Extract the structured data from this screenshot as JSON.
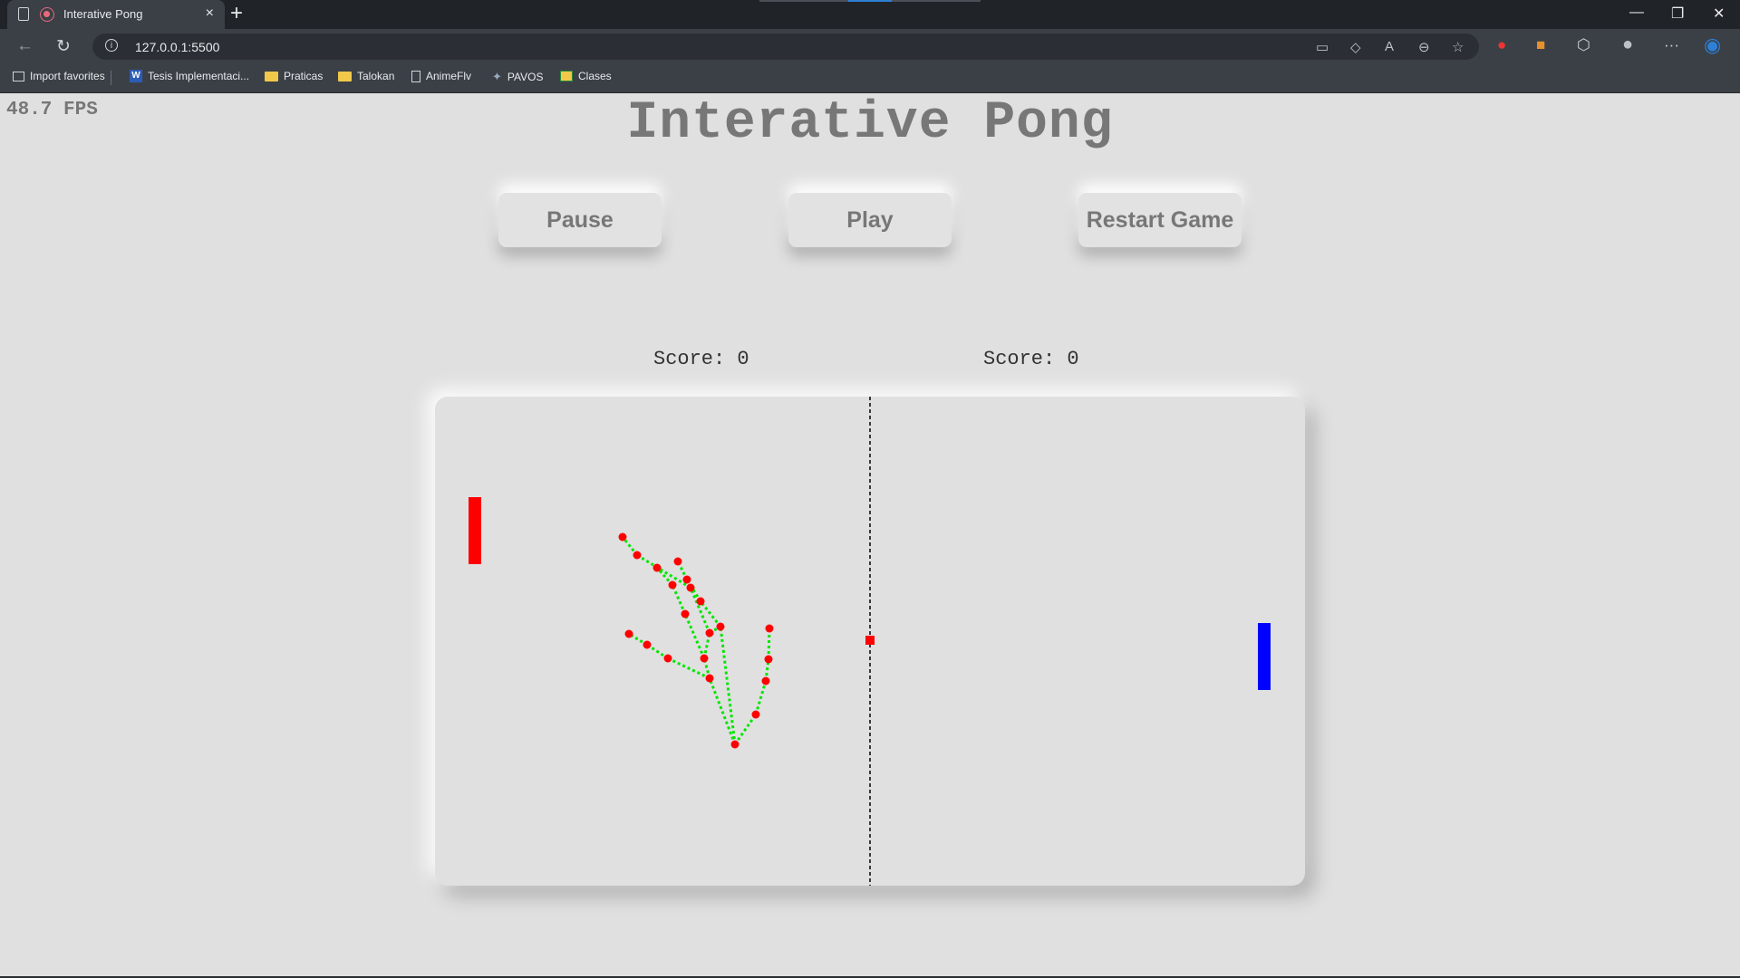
{
  "browser": {
    "tab_title": "Interative Pong",
    "tab_close": "×",
    "new_tab": "+",
    "url": "127.0.0.1:5500",
    "bookmarks": [
      {
        "label": "Import favorites",
        "icon": "import-icon"
      },
      {
        "label": "Tesis Implementaci...",
        "icon": "word-icon"
      },
      {
        "label": "Praticas",
        "icon": "folder-icon"
      },
      {
        "label": "Talokan",
        "icon": "folder-icon"
      },
      {
        "label": "AnimeFlv",
        "icon": "page-icon"
      },
      {
        "label": "PAVOS",
        "icon": "site-icon"
      },
      {
        "label": "Clases",
        "icon": "classroom-icon"
      }
    ]
  },
  "page": {
    "fps": "48.7 FPS",
    "title": "Interative Pong",
    "buttons": {
      "pause": "Pause",
      "play": "Play",
      "restart": "Restart Game"
    },
    "scores": {
      "left": "Score: 0",
      "right": "Score: 0"
    }
  },
  "game": {
    "left_paddle_color": "#ff0000",
    "right_paddle_color": "#0000ff",
    "ball_color": "#ff0000",
    "hand_landmark_color": "#ff0000",
    "hand_skeleton_color": "#00e600",
    "center_line_color": "#000000"
  }
}
